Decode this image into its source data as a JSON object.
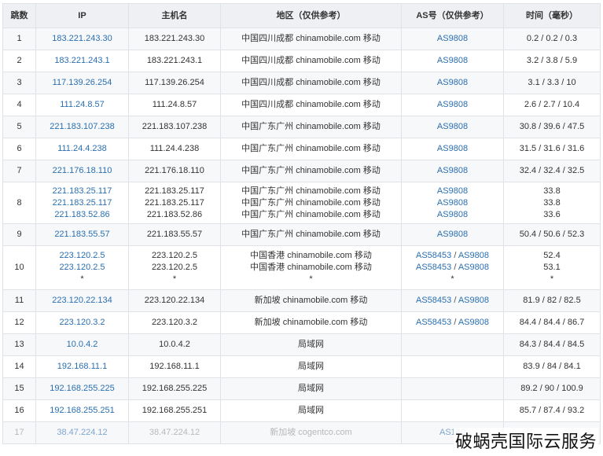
{
  "headers": {
    "hop": "跳数",
    "ip": "IP",
    "hostname": "主机名",
    "region": "地区（仅供参考）",
    "asn": "AS号（仅供参考）",
    "time": "时间（毫秒）"
  },
  "rows": [
    {
      "hop": "1",
      "ip": [
        "183.221.243.30"
      ],
      "host": [
        "183.221.243.30"
      ],
      "region": [
        "中国四川成都 chinamobile.com 移动"
      ],
      "as": [
        [
          "AS9808"
        ]
      ],
      "time": [
        "0.2 / 0.2 / 0.3"
      ]
    },
    {
      "hop": "2",
      "ip": [
        "183.221.243.1"
      ],
      "host": [
        "183.221.243.1"
      ],
      "region": [
        "中国四川成都 chinamobile.com 移动"
      ],
      "as": [
        [
          "AS9808"
        ]
      ],
      "time": [
        "3.2 / 3.8 / 5.9"
      ]
    },
    {
      "hop": "3",
      "ip": [
        "117.139.26.254"
      ],
      "host": [
        "117.139.26.254"
      ],
      "region": [
        "中国四川成都 chinamobile.com 移动"
      ],
      "as": [
        [
          "AS9808"
        ]
      ],
      "time": [
        "3.1 / 3.3 / 10"
      ]
    },
    {
      "hop": "4",
      "ip": [
        "111.24.8.57"
      ],
      "host": [
        "111.24.8.57"
      ],
      "region": [
        "中国四川成都 chinamobile.com 移动"
      ],
      "as": [
        [
          "AS9808"
        ]
      ],
      "time": [
        "2.6 / 2.7 / 10.4"
      ]
    },
    {
      "hop": "5",
      "ip": [
        "221.183.107.238"
      ],
      "host": [
        "221.183.107.238"
      ],
      "region": [
        "中国广东广州 chinamobile.com 移动"
      ],
      "as": [
        [
          "AS9808"
        ]
      ],
      "time": [
        "30.8 / 39.6 / 47.5"
      ]
    },
    {
      "hop": "6",
      "ip": [
        "111.24.4.238"
      ],
      "host": [
        "111.24.4.238"
      ],
      "region": [
        "中国广东广州 chinamobile.com 移动"
      ],
      "as": [
        [
          "AS9808"
        ]
      ],
      "time": [
        "31.5 / 31.6 / 31.6"
      ]
    },
    {
      "hop": "7",
      "ip": [
        "221.176.18.110"
      ],
      "host": [
        "221.176.18.110"
      ],
      "region": [
        "中国广东广州 chinamobile.com 移动"
      ],
      "as": [
        [
          "AS9808"
        ]
      ],
      "time": [
        "32.4 / 32.4 / 32.5"
      ]
    },
    {
      "hop": "8",
      "ip": [
        "221.183.25.117",
        "221.183.25.117",
        "221.183.52.86"
      ],
      "host": [
        "221.183.25.117",
        "221.183.25.117",
        "221.183.52.86"
      ],
      "region": [
        "中国广东广州 chinamobile.com 移动",
        "中国广东广州 chinamobile.com 移动",
        "中国广东广州 chinamobile.com 移动"
      ],
      "as": [
        [
          "AS9808"
        ],
        [
          "AS9808"
        ],
        [
          "AS9808"
        ]
      ],
      "time": [
        "33.8",
        "33.8",
        "33.6"
      ]
    },
    {
      "hop": "9",
      "ip": [
        "221.183.55.57"
      ],
      "host": [
        "221.183.55.57"
      ],
      "region": [
        "中国广东广州 chinamobile.com 移动"
      ],
      "as": [
        [
          "AS9808"
        ]
      ],
      "time": [
        "50.4 / 50.6 / 52.3"
      ]
    },
    {
      "hop": "10",
      "ip": [
        "223.120.2.5",
        "223.120.2.5",
        "*"
      ],
      "host": [
        "223.120.2.5",
        "223.120.2.5",
        "*"
      ],
      "region": [
        "中国香港 chinamobile.com 移动",
        "中国香港 chinamobile.com 移动",
        "*"
      ],
      "as": [
        [
          "AS58453",
          "AS9808"
        ],
        [
          "AS58453",
          "AS9808"
        ],
        [
          "*"
        ]
      ],
      "time": [
        "52.4",
        "53.1",
        "*"
      ]
    },
    {
      "hop": "11",
      "ip": [
        "223.120.22.134"
      ],
      "host": [
        "223.120.22.134"
      ],
      "region": [
        "新加坡 chinamobile.com 移动"
      ],
      "as": [
        [
          "AS58453",
          "AS9808"
        ]
      ],
      "time": [
        "81.9 / 82 / 82.5"
      ]
    },
    {
      "hop": "12",
      "ip": [
        "223.120.3.2"
      ],
      "host": [
        "223.120.3.2"
      ],
      "region": [
        "新加坡 chinamobile.com 移动"
      ],
      "as": [
        [
          "AS58453",
          "AS9808"
        ]
      ],
      "time": [
        "84.4 / 84.4 / 86.7"
      ]
    },
    {
      "hop": "13",
      "ip": [
        "10.0.4.2"
      ],
      "host": [
        "10.0.4.2"
      ],
      "region": [
        "局域网"
      ],
      "as": [],
      "time": [
        "84.3 / 84.4 / 84.5"
      ]
    },
    {
      "hop": "14",
      "ip": [
        "192.168.11.1"
      ],
      "host": [
        "192.168.11.1"
      ],
      "region": [
        "局域网"
      ],
      "as": [],
      "time": [
        "83.9 / 84 / 84.1"
      ]
    },
    {
      "hop": "15",
      "ip": [
        "192.168.255.225"
      ],
      "host": [
        "192.168.255.225"
      ],
      "region": [
        "局域网"
      ],
      "as": [],
      "time": [
        "89.2 / 90 / 100.9"
      ]
    },
    {
      "hop": "16",
      "ip": [
        "192.168.255.251"
      ],
      "host": [
        "192.168.255.251"
      ],
      "region": [
        "局域网"
      ],
      "as": [],
      "time": [
        "85.7 / 87.4 / 93.2"
      ]
    },
    {
      "hop": "17",
      "ip": [
        "38.47.224.12"
      ],
      "host": [
        "38.47.224.12"
      ],
      "region": [
        "新加坡 cogentco.com"
      ],
      "as": [
        [
          "AS140"
        ]
      ],
      "time": [
        ""
      ],
      "faded": true
    }
  ],
  "as_separator": " / ",
  "watermark": "破蜗壳国际云服务",
  "colors": {
    "link": "#2a6fb0",
    "header_bg": "#eef0f3",
    "border": "#dfe3e8"
  }
}
